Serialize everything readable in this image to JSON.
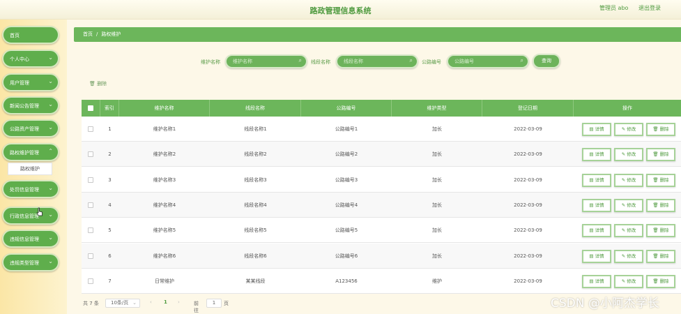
{
  "header": {
    "title": "路政管理信息系统",
    "admin_label": "管理员 abo",
    "logout_label": "退出登录"
  },
  "sidebar": {
    "items": [
      {
        "label": "首页"
      },
      {
        "label": "个人中心"
      },
      {
        "label": "用户管理"
      },
      {
        "label": "新闻公告管理"
      },
      {
        "label": "公路资产管理"
      },
      {
        "label": "路权维护管理"
      },
      {
        "label": "处罚信息管理"
      },
      {
        "label": "行政信息管理"
      },
      {
        "label": "违规信息管理"
      },
      {
        "label": "违规类型管理"
      }
    ],
    "submenu_label": "路权维护"
  },
  "breadcrumb": {
    "home": "首页",
    "separator": "/",
    "current": "路权维护"
  },
  "search": {
    "field1_label": "维护名称",
    "field1_placeholder": "维护名称",
    "field2_label": "线段名称",
    "field2_placeholder": "线段名称",
    "field3_label": "公路编号",
    "field3_placeholder": "公路编号",
    "button_label": "查询"
  },
  "toolbar": {
    "delete_label": "删除"
  },
  "table": {
    "headers": [
      "索引",
      "维护名称",
      "线段名称",
      "公路编号",
      "维护类型",
      "登记日期",
      "操作"
    ],
    "rows": [
      {
        "index": "1",
        "name": "维护名称1",
        "segment": "线段名称1",
        "road": "公路编号1",
        "type": "加长",
        "date": "2022-03-09"
      },
      {
        "index": "2",
        "name": "维护名称2",
        "segment": "线段名称2",
        "road": "公路编号2",
        "type": "加长",
        "date": "2022-03-09"
      },
      {
        "index": "3",
        "name": "维护名称3",
        "segment": "线段名称3",
        "road": "公路编号3",
        "type": "加长",
        "date": "2022-03-09"
      },
      {
        "index": "4",
        "name": "维护名称4",
        "segment": "线段名称4",
        "road": "公路编号4",
        "type": "加长",
        "date": "2022-03-09"
      },
      {
        "index": "5",
        "name": "维护名称5",
        "segment": "线段名称5",
        "road": "公路编号5",
        "type": "加长",
        "date": "2022-03-09"
      },
      {
        "index": "6",
        "name": "维护名称6",
        "segment": "线段名称6",
        "road": "公路编号6",
        "type": "加长",
        "date": "2022-03-09"
      },
      {
        "index": "7",
        "name": "日常维护",
        "segment": "某某线段",
        "road": "A123456",
        "type": "维护",
        "date": "2022-03-09"
      }
    ],
    "actions": {
      "detail": "详情",
      "edit": "修改",
      "delete": "删除"
    }
  },
  "pagination": {
    "total": "共 7 条",
    "page_size": "10条/页",
    "current_page": "1",
    "goto_label": "前往",
    "goto_value": "1",
    "page_suffix": "页"
  },
  "watermark": "CSDN @小阿杰学长",
  "colors": {
    "primary_green": "#6cb65b",
    "sidebar_bg": "#fbe6a6"
  }
}
